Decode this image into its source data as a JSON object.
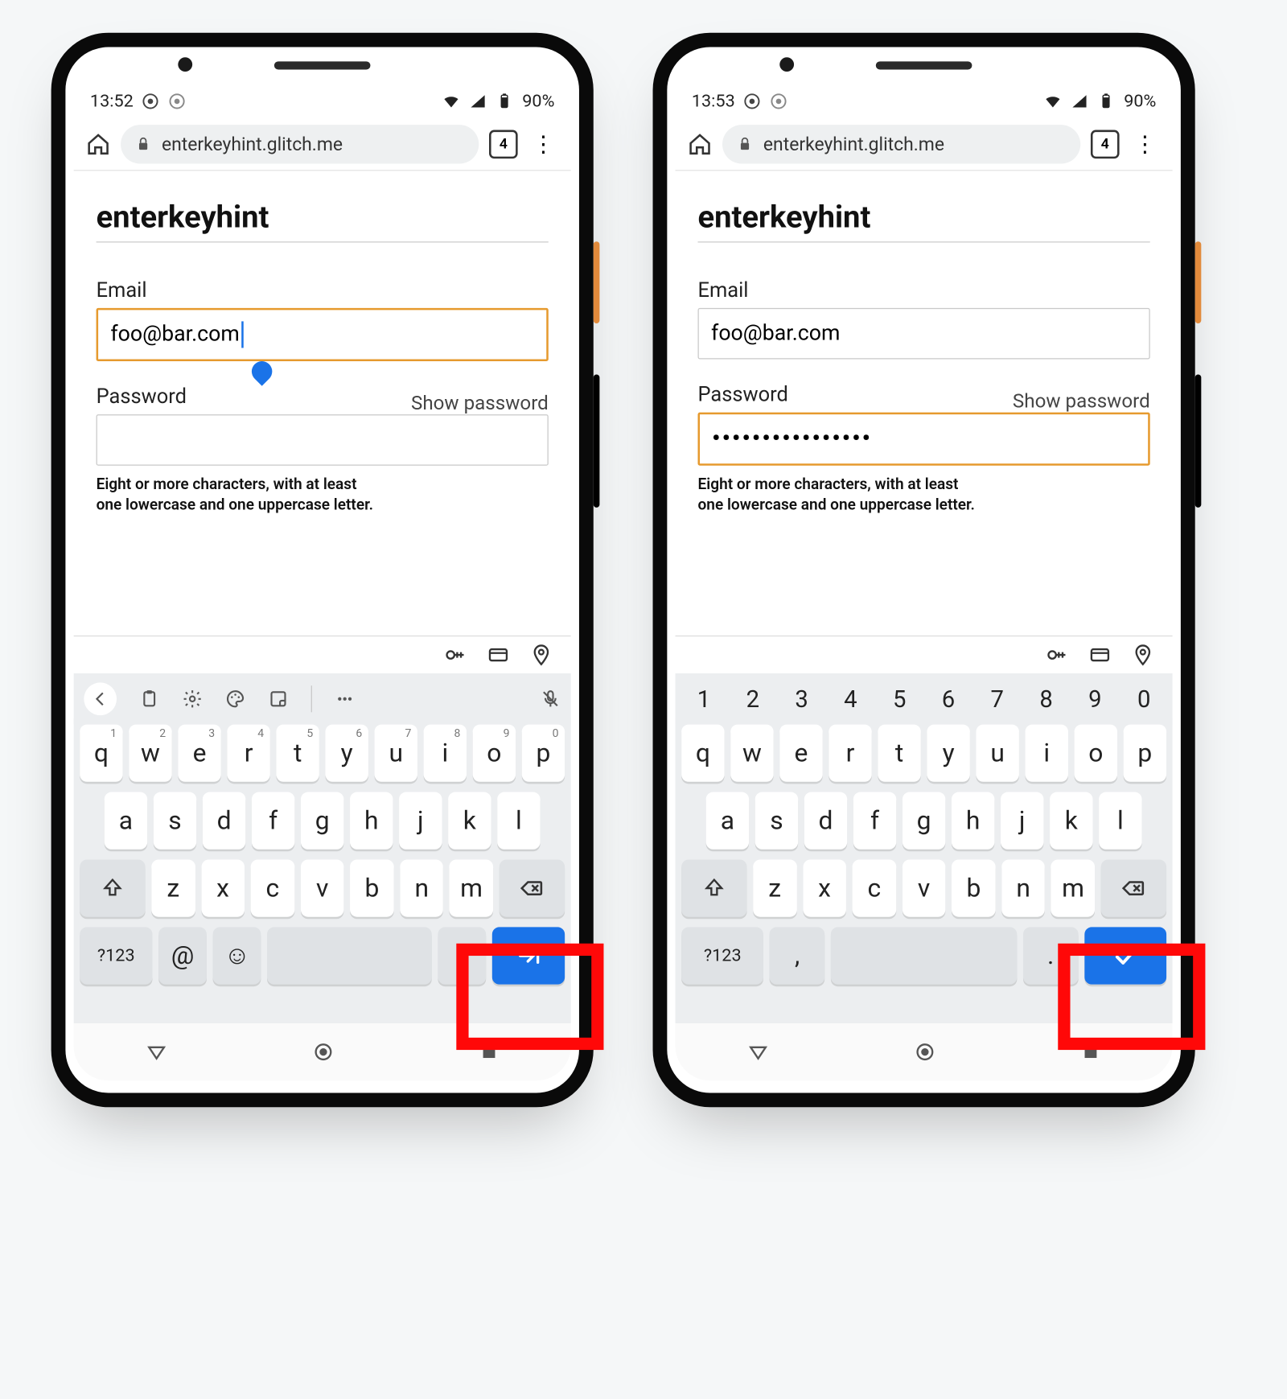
{
  "status": {
    "time_left": "13:52",
    "time_right": "13:53",
    "battery": "90%"
  },
  "browser": {
    "url": "enterkeyhint.glitch.me",
    "tab_count": "4"
  },
  "page": {
    "title": "enterkeyhint",
    "email_label": "Email",
    "email_value": "foo@bar.com",
    "password_label": "Password",
    "show_password": "Show password",
    "password_masked": "••••••••••••••••",
    "help_line1": "Eight or more characters, with at least",
    "help_line2": "one lowercase and one uppercase letter."
  },
  "keyboard": {
    "row1": [
      "q",
      "w",
      "e",
      "r",
      "t",
      "y",
      "u",
      "i",
      "o",
      "p"
    ],
    "row1_sup": [
      "1",
      "2",
      "3",
      "4",
      "5",
      "6",
      "7",
      "8",
      "9",
      "0"
    ],
    "row2": [
      "a",
      "s",
      "d",
      "f",
      "g",
      "h",
      "j",
      "k",
      "l"
    ],
    "row3": [
      "z",
      "x",
      "c",
      "v",
      "b",
      "n",
      "m"
    ],
    "sym_label": "?123",
    "numrow": [
      "1",
      "2",
      "3",
      "4",
      "5",
      "6",
      "7",
      "8",
      "9",
      "0"
    ],
    "at": "@",
    "comma": ",",
    "period": "."
  }
}
